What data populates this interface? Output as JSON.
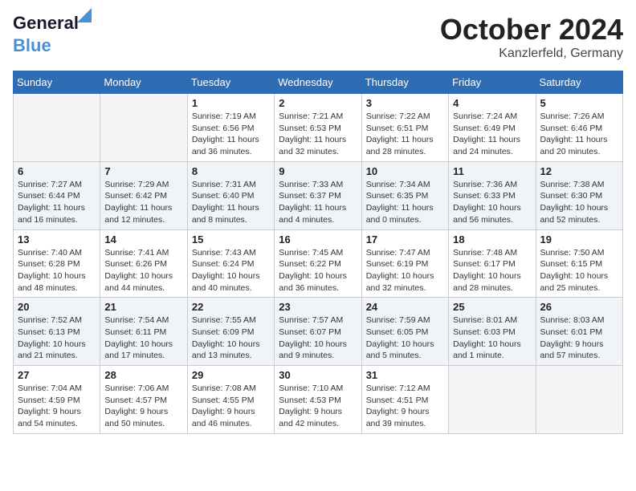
{
  "header": {
    "logo_line1": "General",
    "logo_line2": "Blue",
    "month": "October 2024",
    "location": "Kanzlerfeld, Germany"
  },
  "weekdays": [
    "Sunday",
    "Monday",
    "Tuesday",
    "Wednesday",
    "Thursday",
    "Friday",
    "Saturday"
  ],
  "weeks": [
    [
      {
        "num": "",
        "empty": true
      },
      {
        "num": "",
        "empty": true
      },
      {
        "num": "1",
        "sunrise": "Sunrise: 7:19 AM",
        "sunset": "Sunset: 6:56 PM",
        "daylight": "Daylight: 11 hours and 36 minutes."
      },
      {
        "num": "2",
        "sunrise": "Sunrise: 7:21 AM",
        "sunset": "Sunset: 6:53 PM",
        "daylight": "Daylight: 11 hours and 32 minutes."
      },
      {
        "num": "3",
        "sunrise": "Sunrise: 7:22 AM",
        "sunset": "Sunset: 6:51 PM",
        "daylight": "Daylight: 11 hours and 28 minutes."
      },
      {
        "num": "4",
        "sunrise": "Sunrise: 7:24 AM",
        "sunset": "Sunset: 6:49 PM",
        "daylight": "Daylight: 11 hours and 24 minutes."
      },
      {
        "num": "5",
        "sunrise": "Sunrise: 7:26 AM",
        "sunset": "Sunset: 6:46 PM",
        "daylight": "Daylight: 11 hours and 20 minutes."
      }
    ],
    [
      {
        "num": "6",
        "sunrise": "Sunrise: 7:27 AM",
        "sunset": "Sunset: 6:44 PM",
        "daylight": "Daylight: 11 hours and 16 minutes."
      },
      {
        "num": "7",
        "sunrise": "Sunrise: 7:29 AM",
        "sunset": "Sunset: 6:42 PM",
        "daylight": "Daylight: 11 hours and 12 minutes."
      },
      {
        "num": "8",
        "sunrise": "Sunrise: 7:31 AM",
        "sunset": "Sunset: 6:40 PM",
        "daylight": "Daylight: 11 hours and 8 minutes."
      },
      {
        "num": "9",
        "sunrise": "Sunrise: 7:33 AM",
        "sunset": "Sunset: 6:37 PM",
        "daylight": "Daylight: 11 hours and 4 minutes."
      },
      {
        "num": "10",
        "sunrise": "Sunrise: 7:34 AM",
        "sunset": "Sunset: 6:35 PM",
        "daylight": "Daylight: 11 hours and 0 minutes."
      },
      {
        "num": "11",
        "sunrise": "Sunrise: 7:36 AM",
        "sunset": "Sunset: 6:33 PM",
        "daylight": "Daylight: 10 hours and 56 minutes."
      },
      {
        "num": "12",
        "sunrise": "Sunrise: 7:38 AM",
        "sunset": "Sunset: 6:30 PM",
        "daylight": "Daylight: 10 hours and 52 minutes."
      }
    ],
    [
      {
        "num": "13",
        "sunrise": "Sunrise: 7:40 AM",
        "sunset": "Sunset: 6:28 PM",
        "daylight": "Daylight: 10 hours and 48 minutes."
      },
      {
        "num": "14",
        "sunrise": "Sunrise: 7:41 AM",
        "sunset": "Sunset: 6:26 PM",
        "daylight": "Daylight: 10 hours and 44 minutes."
      },
      {
        "num": "15",
        "sunrise": "Sunrise: 7:43 AM",
        "sunset": "Sunset: 6:24 PM",
        "daylight": "Daylight: 10 hours and 40 minutes."
      },
      {
        "num": "16",
        "sunrise": "Sunrise: 7:45 AM",
        "sunset": "Sunset: 6:22 PM",
        "daylight": "Daylight: 10 hours and 36 minutes."
      },
      {
        "num": "17",
        "sunrise": "Sunrise: 7:47 AM",
        "sunset": "Sunset: 6:19 PM",
        "daylight": "Daylight: 10 hours and 32 minutes."
      },
      {
        "num": "18",
        "sunrise": "Sunrise: 7:48 AM",
        "sunset": "Sunset: 6:17 PM",
        "daylight": "Daylight: 10 hours and 28 minutes."
      },
      {
        "num": "19",
        "sunrise": "Sunrise: 7:50 AM",
        "sunset": "Sunset: 6:15 PM",
        "daylight": "Daylight: 10 hours and 25 minutes."
      }
    ],
    [
      {
        "num": "20",
        "sunrise": "Sunrise: 7:52 AM",
        "sunset": "Sunset: 6:13 PM",
        "daylight": "Daylight: 10 hours and 21 minutes."
      },
      {
        "num": "21",
        "sunrise": "Sunrise: 7:54 AM",
        "sunset": "Sunset: 6:11 PM",
        "daylight": "Daylight: 10 hours and 17 minutes."
      },
      {
        "num": "22",
        "sunrise": "Sunrise: 7:55 AM",
        "sunset": "Sunset: 6:09 PM",
        "daylight": "Daylight: 10 hours and 13 minutes."
      },
      {
        "num": "23",
        "sunrise": "Sunrise: 7:57 AM",
        "sunset": "Sunset: 6:07 PM",
        "daylight": "Daylight: 10 hours and 9 minutes."
      },
      {
        "num": "24",
        "sunrise": "Sunrise: 7:59 AM",
        "sunset": "Sunset: 6:05 PM",
        "daylight": "Daylight: 10 hours and 5 minutes."
      },
      {
        "num": "25",
        "sunrise": "Sunrise: 8:01 AM",
        "sunset": "Sunset: 6:03 PM",
        "daylight": "Daylight: 10 hours and 1 minute."
      },
      {
        "num": "26",
        "sunrise": "Sunrise: 8:03 AM",
        "sunset": "Sunset: 6:01 PM",
        "daylight": "Daylight: 9 hours and 57 minutes."
      }
    ],
    [
      {
        "num": "27",
        "sunrise": "Sunrise: 7:04 AM",
        "sunset": "Sunset: 4:59 PM",
        "daylight": "Daylight: 9 hours and 54 minutes."
      },
      {
        "num": "28",
        "sunrise": "Sunrise: 7:06 AM",
        "sunset": "Sunset: 4:57 PM",
        "daylight": "Daylight: 9 hours and 50 minutes."
      },
      {
        "num": "29",
        "sunrise": "Sunrise: 7:08 AM",
        "sunset": "Sunset: 4:55 PM",
        "daylight": "Daylight: 9 hours and 46 minutes."
      },
      {
        "num": "30",
        "sunrise": "Sunrise: 7:10 AM",
        "sunset": "Sunset: 4:53 PM",
        "daylight": "Daylight: 9 hours and 42 minutes."
      },
      {
        "num": "31",
        "sunrise": "Sunrise: 7:12 AM",
        "sunset": "Sunset: 4:51 PM",
        "daylight": "Daylight: 9 hours and 39 minutes."
      },
      {
        "num": "",
        "empty": true
      },
      {
        "num": "",
        "empty": true
      }
    ]
  ]
}
